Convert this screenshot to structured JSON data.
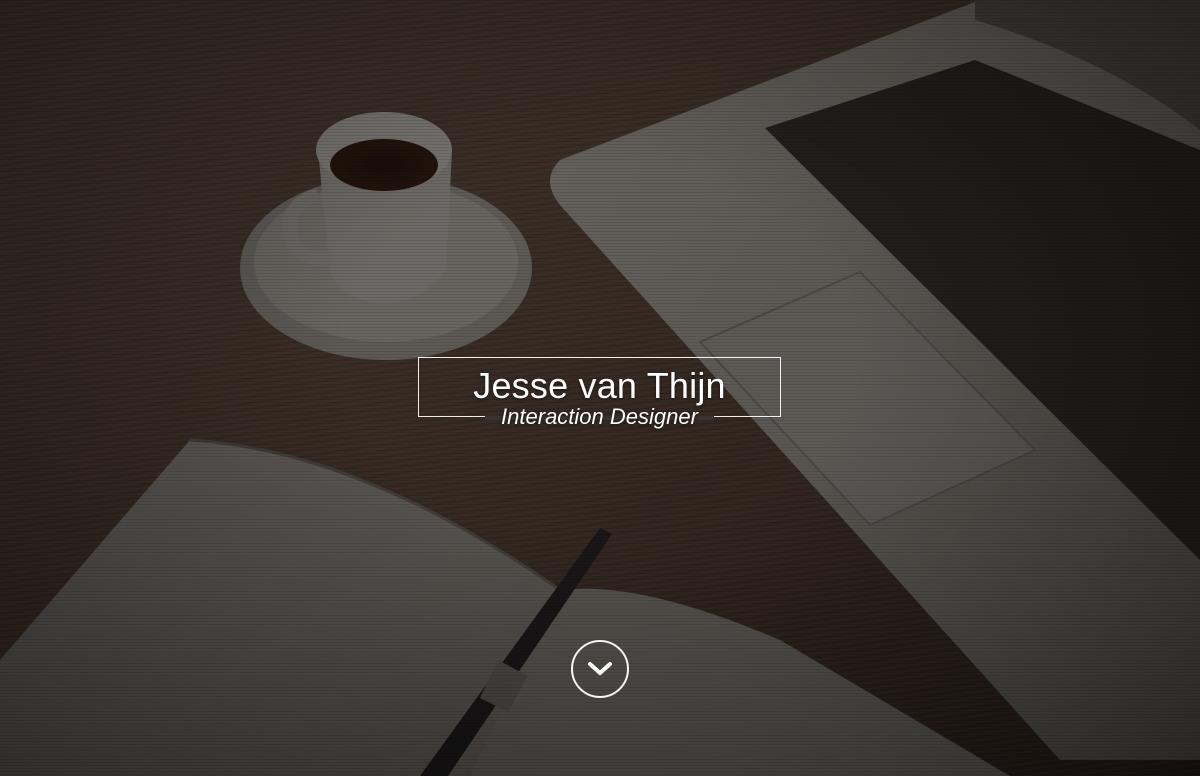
{
  "hero": {
    "name": "Jesse van Thijn",
    "role": "Interaction Designer",
    "scroll_icon": "chevron-down-icon"
  },
  "colors": {
    "text": "#ffffff",
    "desk": "#4a3a30",
    "overlay": "#1b1714"
  },
  "background": {
    "icons": [
      "coffee-cup-icon",
      "laptop-icon",
      "notebook-icon",
      "pen-icon"
    ]
  }
}
